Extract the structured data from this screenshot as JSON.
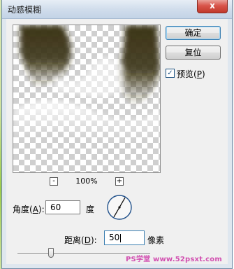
{
  "dialog": {
    "title": "动感模糊",
    "close_glyph": "x"
  },
  "preview": {
    "zoom_out_glyph": "-",
    "zoom_in_glyph": "+",
    "zoom_level": "100%"
  },
  "buttons": {
    "ok_label": "确定",
    "reset_label": "复位"
  },
  "preview_toggle": {
    "label_prefix": "预览(",
    "label_key": "P",
    "label_suffix": ")",
    "checked": true,
    "check_glyph": "✓"
  },
  "angle": {
    "label_prefix": "角度(",
    "label_key": "A",
    "label_suffix": "):",
    "value": "60",
    "unit": "度",
    "degrees": 60
  },
  "distance": {
    "label_prefix": "距离(",
    "label_key": "D",
    "label_suffix": "):",
    "value": "50",
    "unit": "像素",
    "slider_fraction": 0.25
  },
  "watermark": "PS学堂 www.52psxt.com",
  "colors": {
    "dark_shape": "#3b3414",
    "accent_border": "#3c7fb1",
    "close_red": "#d9544a"
  }
}
